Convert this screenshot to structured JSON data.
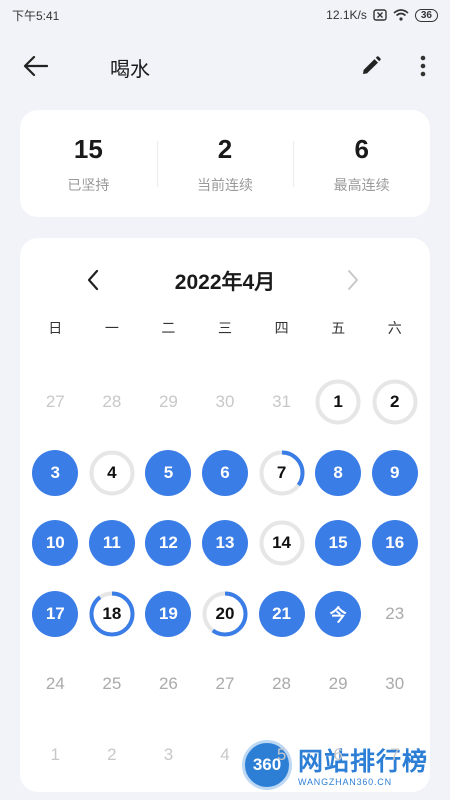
{
  "status_bar": {
    "time": "下午5:41",
    "speed": "12.1K/s",
    "battery": "36"
  },
  "header": {
    "title": "喝水"
  },
  "stats": [
    {
      "value": "15",
      "label": "已坚持"
    },
    {
      "value": "2",
      "label": "当前连续"
    },
    {
      "value": "6",
      "label": "最高连续"
    }
  ],
  "calendar": {
    "month_title": "2022年4月",
    "weekdays": [
      "日",
      "一",
      "二",
      "三",
      "四",
      "五",
      "六"
    ],
    "days": [
      {
        "label": "27",
        "state": "other"
      },
      {
        "label": "28",
        "state": "other"
      },
      {
        "label": "29",
        "state": "other"
      },
      {
        "label": "30",
        "state": "other"
      },
      {
        "label": "31",
        "state": "other"
      },
      {
        "label": "1",
        "state": "partial",
        "progress": 0
      },
      {
        "label": "2",
        "state": "partial",
        "progress": 0
      },
      {
        "label": "3",
        "state": "done"
      },
      {
        "label": "4",
        "state": "partial",
        "progress": 0
      },
      {
        "label": "5",
        "state": "done"
      },
      {
        "label": "6",
        "state": "done"
      },
      {
        "label": "7",
        "state": "partial",
        "progress": 0.35
      },
      {
        "label": "8",
        "state": "done"
      },
      {
        "label": "9",
        "state": "done"
      },
      {
        "label": "10",
        "state": "done"
      },
      {
        "label": "11",
        "state": "done"
      },
      {
        "label": "12",
        "state": "done"
      },
      {
        "label": "13",
        "state": "done"
      },
      {
        "label": "14",
        "state": "partial",
        "progress": 0
      },
      {
        "label": "15",
        "state": "done"
      },
      {
        "label": "16",
        "state": "done"
      },
      {
        "label": "17",
        "state": "done"
      },
      {
        "label": "18",
        "state": "partial",
        "progress": 0.9
      },
      {
        "label": "19",
        "state": "done"
      },
      {
        "label": "20",
        "state": "partial",
        "progress": 0.6
      },
      {
        "label": "21",
        "state": "done"
      },
      {
        "label": "今",
        "state": "done"
      },
      {
        "label": "23",
        "state": "future"
      },
      {
        "label": "24",
        "state": "future"
      },
      {
        "label": "25",
        "state": "future"
      },
      {
        "label": "26",
        "state": "future"
      },
      {
        "label": "27",
        "state": "future"
      },
      {
        "label": "28",
        "state": "future"
      },
      {
        "label": "29",
        "state": "future"
      },
      {
        "label": "30",
        "state": "future"
      },
      {
        "label": "1",
        "state": "other"
      },
      {
        "label": "2",
        "state": "other"
      },
      {
        "label": "3",
        "state": "other"
      },
      {
        "label": "4",
        "state": "other"
      },
      {
        "label": "5",
        "state": "other"
      },
      {
        "label": "6",
        "state": "other"
      },
      {
        "label": "7",
        "state": "other"
      }
    ]
  },
  "colors": {
    "accent": "#3b7de6",
    "ring_track": "#e6e6e6"
  },
  "watermark": {
    "logo": "360",
    "text": "网站排行榜",
    "sub": "WANGZHAN360.CN"
  }
}
